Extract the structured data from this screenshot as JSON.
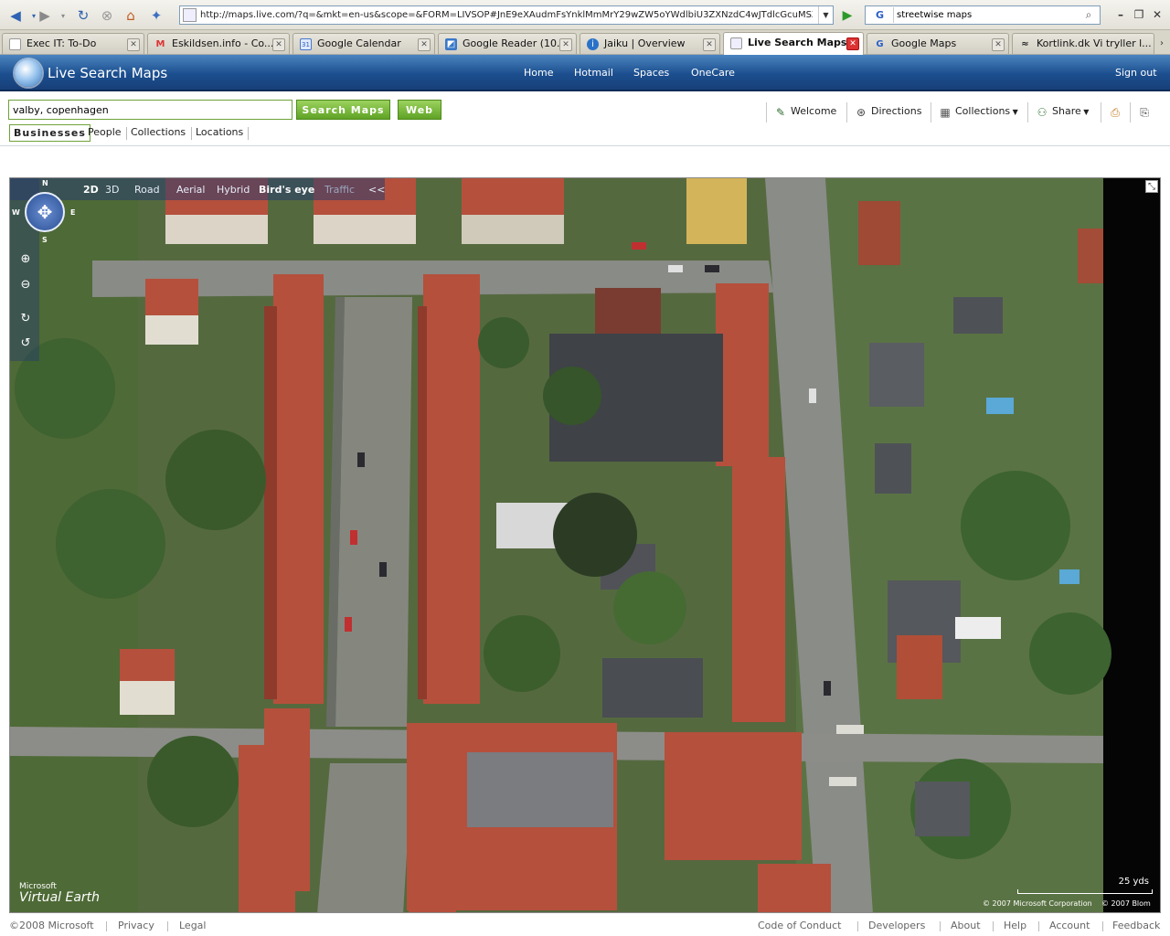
{
  "browser": {
    "url": "http://maps.live.com/?q=&mkt=en-us&scope=&FORM=LIVSOP#JnE9eXAudmFsYnklMmMrY29wZW5oYWdlbiU3ZXNzdC4wJTdlcGcuMSZlYj",
    "search_engine_label": "G",
    "search_value": "streetwise maps",
    "tabs": [
      {
        "label": "Exec IT: To-Do",
        "icon": "page-icon"
      },
      {
        "label": "Eskildsen.info - Co...",
        "icon": "gmail-icon"
      },
      {
        "label": "Google Calendar",
        "icon": "calendar-icon"
      },
      {
        "label": "Google Reader (10...",
        "icon": "reader-icon"
      },
      {
        "label": "Jaiku | Overview",
        "icon": "jaiku-icon"
      },
      {
        "label": "Live Search Maps",
        "icon": "page-icon"
      },
      {
        "label": "Google Maps",
        "icon": "google-icon"
      },
      {
        "label": "Kortlink.dk Vi tryller l...",
        "icon": "kortlink-icon"
      }
    ]
  },
  "header": {
    "title": "Live Search Maps",
    "nav": [
      "Home",
      "Hotmail",
      "Spaces",
      "OneCare"
    ],
    "signout": "Sign out"
  },
  "search": {
    "query": "valby, copenhagen",
    "search_maps_label": "Search Maps",
    "web_label": "Web",
    "categories": [
      "Businesses",
      "People",
      "Collections",
      "Locations"
    ],
    "tools": [
      "Welcome",
      "Directions",
      "Collections",
      "Share"
    ]
  },
  "map": {
    "views": [
      "2D",
      "3D",
      "Road",
      "Aerial",
      "Hybrid",
      "Bird's eye",
      "Traffic",
      "<<"
    ],
    "active_view": "Bird's eye",
    "compass": {
      "n": "N",
      "s": "S",
      "e": "E",
      "w": "W"
    },
    "brand_line1": "Microsoft",
    "brand_line2": "Virtual Earth",
    "scale_label": "25 yds",
    "copyright1": "© 2007 Microsoft Corporation",
    "copyright2": "© 2007 Blom"
  },
  "footer": {
    "copyright": "©2008 Microsoft",
    "left_links": [
      "Privacy",
      "Legal"
    ],
    "right_links": [
      "Code of Conduct",
      "Developers",
      "About",
      "Help",
      "Account",
      "Feedback"
    ]
  },
  "colors": {
    "header_blue": "#1c4f8f",
    "button_green": "#5fa325",
    "roof_red": "#b5503c"
  }
}
